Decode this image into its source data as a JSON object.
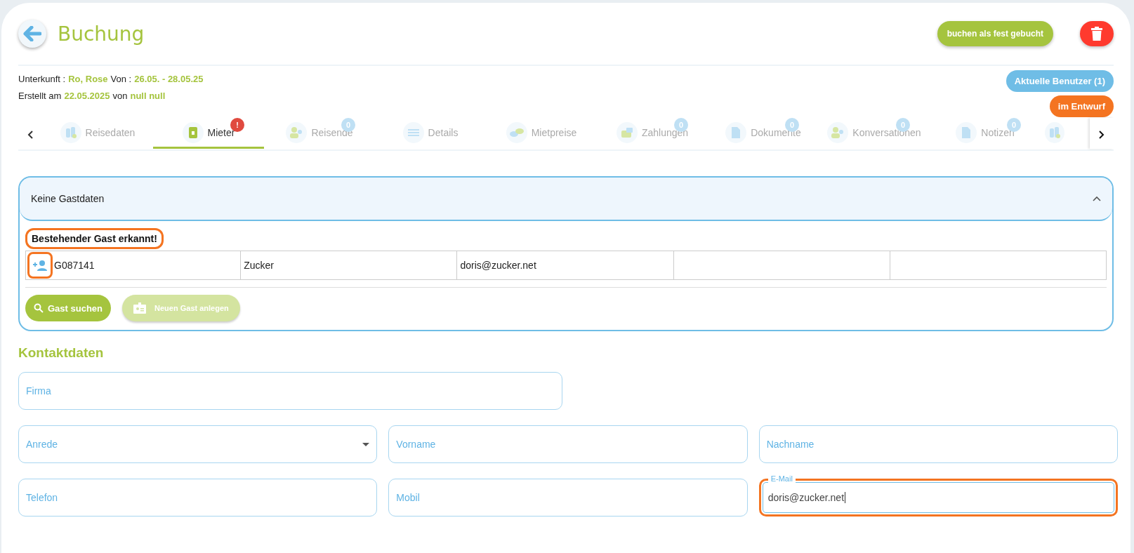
{
  "header": {
    "title": "Buchung",
    "confirm_button": "buchen als fest gebucht"
  },
  "info": {
    "lines": [
      [
        {
          "text": "Unterkunft :",
          "accent": false
        },
        {
          "text": "Ro, Rose",
          "accent": true
        },
        {
          "text": "Von :",
          "accent": false
        },
        {
          "text": "26.05. - 28.05.25",
          "accent": true
        }
      ],
      [
        {
          "text": "Erstellt am",
          "accent": false
        },
        {
          "text": "22.05.2025",
          "accent": true
        },
        {
          "text": "von",
          "accent": false
        },
        {
          "text": "null null",
          "accent": true
        }
      ]
    ],
    "pills": [
      {
        "label": "Aktuelle Benutzer (1)",
        "color": "#6fbde6"
      },
      {
        "label": "im Entwurf",
        "color": "#f47421"
      }
    ]
  },
  "tabs": [
    {
      "label": "Reisedaten",
      "selected": false
    },
    {
      "label": "Mieter",
      "selected": true,
      "badge": {
        "text": "!",
        "color": "#e04a3f"
      }
    },
    {
      "label": "Reisende",
      "selected": false,
      "badge": {
        "text": "0",
        "color": "#bfe0f4"
      }
    },
    {
      "label": "Details",
      "selected": false
    },
    {
      "label": "Mietpreise",
      "selected": false
    },
    {
      "label": "Zahlungen",
      "selected": false,
      "badge": {
        "text": "0",
        "color": "#bfe0f4"
      }
    },
    {
      "label": "Dokumente",
      "selected": false,
      "badge": {
        "text": "0",
        "color": "#bfe0f4"
      }
    },
    {
      "label": "Konversationen",
      "selected": false,
      "badge": {
        "text": "0",
        "color": "#bfe0f4"
      }
    },
    {
      "label": "Notizen",
      "selected": false,
      "badge": {
        "text": "0",
        "color": "#bfe0f4"
      }
    },
    {
      "selected": false
    }
  ],
  "guest_panel": {
    "title": "Keine Gastdaten",
    "expanded": true,
    "message": "Bestehender Gast erkannt!",
    "message_highlighted": true,
    "row": {
      "icon_highlighted": true,
      "cells": [
        "G087141",
        "Zucker",
        "doris@zucker.net",
        "",
        ""
      ]
    },
    "buttons": [
      {
        "label": "Gast suchen",
        "disabled": false
      },
      {
        "label": "Neuen Gast anlegen",
        "disabled": true
      }
    ]
  },
  "contact": {
    "title": "Kontaktdaten",
    "rows": [
      [
        {
          "kind": "text",
          "placeholder": "Firma",
          "highlighted": false
        }
      ],
      [
        {
          "kind": "select",
          "placeholder": "Anrede",
          "highlighted": false
        },
        {
          "kind": "text",
          "placeholder": "Vorname",
          "highlighted": false
        },
        {
          "kind": "text",
          "placeholder": "Nachname",
          "highlighted": false
        }
      ],
      [
        {
          "kind": "text",
          "placeholder": "Telefon",
          "highlighted": false
        },
        {
          "kind": "text",
          "placeholder": "Mobil",
          "highlighted": false
        },
        {
          "kind": "text",
          "label": "E-Mail",
          "value": "doris@zucker.net",
          "highlighted": true
        }
      ]
    ]
  }
}
